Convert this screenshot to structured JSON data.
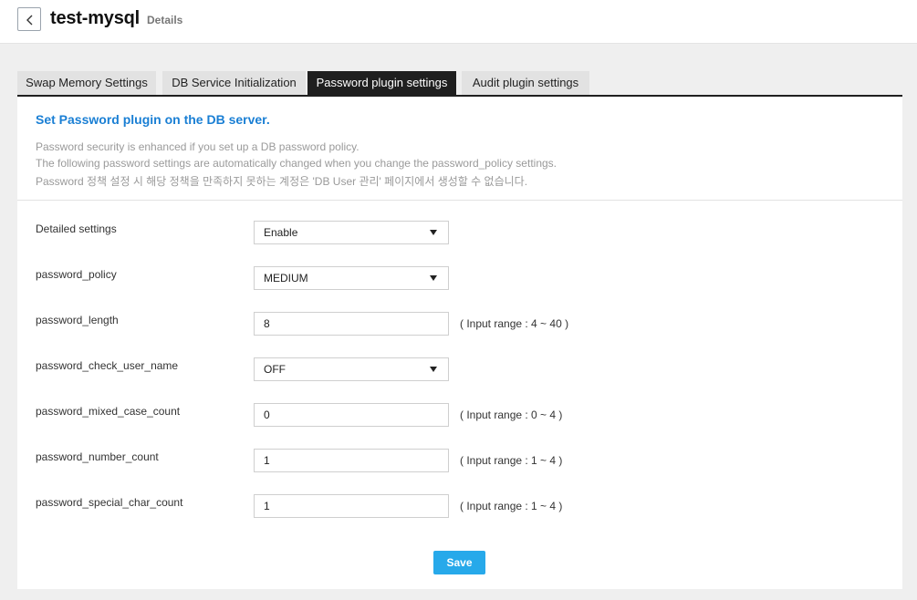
{
  "header": {
    "title": "test-mysql",
    "subtitle": "Details",
    "back_icon": "chevron-left-icon"
  },
  "tabs": [
    {
      "label": "Swap Memory Settings",
      "active": false
    },
    {
      "label": "DB Service Initialization",
      "active": false
    },
    {
      "label": "Password plugin settings",
      "active": true
    },
    {
      "label": "Audit plugin settings",
      "active": false
    }
  ],
  "notice": {
    "heading": "Set Password plugin on the DB server.",
    "lines": [
      "Password security is enhanced if you set up a DB password policy.",
      "The following password settings are automatically changed when you change the password_policy settings.",
      "Password 정책 설정 시 해당 정책을 만족하지 못하는 계정은 'DB User 관리' 페이지에서 생성할 수 없습니다."
    ]
  },
  "form": {
    "rows": [
      {
        "label": "Detailed settings",
        "type": "select",
        "value": "Enable",
        "range": ""
      },
      {
        "label": "password_policy",
        "type": "select",
        "value": "MEDIUM",
        "range": ""
      },
      {
        "label": "password_length",
        "type": "input",
        "value": "8",
        "range": "( Input range : 4 ~ 40 )"
      },
      {
        "label": "password_check_user_name",
        "type": "select",
        "value": "OFF",
        "range": ""
      },
      {
        "label": "password_mixed_case_count",
        "type": "input",
        "value": "0",
        "range": "( Input range : 0 ~ 4 )"
      },
      {
        "label": "password_number_count",
        "type": "input",
        "value": "1",
        "range": "( Input range : 1 ~ 4 )"
      },
      {
        "label": "password_special_char_count",
        "type": "input",
        "value": "1",
        "range": "( Input range : 1 ~ 4 )"
      }
    ],
    "save_label": "Save"
  },
  "colors": {
    "accent": "#1a7fd4",
    "save_button": "#27a9ea",
    "active_tab": "#1f1f1f",
    "inactive_tab": "#e2e2e2"
  }
}
